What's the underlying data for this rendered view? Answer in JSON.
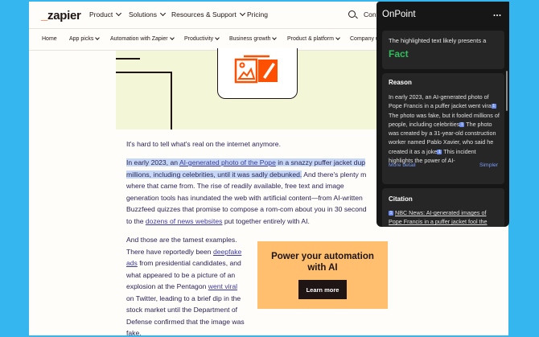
{
  "nav": {
    "logo_mark": "_",
    "logo_text": "zapier",
    "items": [
      "Product",
      "Solutions",
      "Resources & Support",
      "Pricing"
    ],
    "contact": "Cont"
  },
  "subnav": {
    "items": [
      "Home",
      "App picks",
      "Automation with Zapier",
      "Productivity",
      "Business growth",
      "Product & platform",
      "Company u"
    ]
  },
  "article": {
    "p1": "It's hard to tell what's real on the internet anymore.",
    "p2": {
      "l1_a": "In early 2023, an ",
      "l1_link": "AI-generated photo of the Pope",
      "l1_b": " in a snazzy puffer jacket dup",
      "l2_hl": "millions, including celebrities, until it was sadly debunked.",
      "l2_b": " And there's plenty m",
      "l3": "where that came from. The rise of readily available, free text and image",
      "l4": "generation tools has inundated the web with artificial content—from AI-written",
      "l5": "Buzzfeed quizzes that promise to compose a rom-com about you in 30 second",
      "l6_a": "to the ",
      "l6_link": "dozens of news websites",
      "l6_b": " put together entirely with AI."
    },
    "p3": {
      "l1": "And those are the tamest examples.",
      "l2_a": "There have reportedly been ",
      "l2_link": "deepfake",
      "l3_link": "ads",
      "l3_b": " from presidential candidates, and",
      "l4": "what appeared to be a picture of an",
      "l5_a": "explosion at the Pentagon ",
      "l5_link": "went viral",
      "l6": "on Twitter, leading to a brief dip in the",
      "l7": "stock market until the Department of",
      "l8": "Defense confirmed that the image was",
      "l9": "fake."
    },
    "promo": {
      "title_l1": "Power your automation",
      "title_l2": "with AI",
      "button": "Learn more"
    }
  },
  "panel": {
    "title": "OnPoint",
    "verdict_intro": "The highlighted text likely presents a",
    "verdict": "Fact",
    "reason": {
      "heading": "Reason",
      "text_1": "In early 2023, an AI-generated photo of Pope Francis in a puffer jacket went vira",
      "text_2": " The photo was fake, but it fooled millions of people, including celebrities",
      "text_3": " The photo was created by a 31-year-old construction worker named Pablo Xavier, who said he created it as a joke",
      "text_4": " This incident highlights the power of AI-",
      "more": "More detail",
      "simpler": "Simpler"
    },
    "citation": {
      "heading": "Citation",
      "text": "NBC News: AI-generated images of Pope Francis in a puffer jacket fool the"
    },
    "ref_label": "1"
  },
  "colors": {
    "background": "#36b6ef",
    "page": "#fffdf9",
    "brand": "#ff4f00",
    "highlight": "#c6d8f5",
    "promo": "#ffbf6e",
    "panel": "#161616",
    "fact": "#2fbe5b",
    "panel_link": "#7a9cf8"
  }
}
